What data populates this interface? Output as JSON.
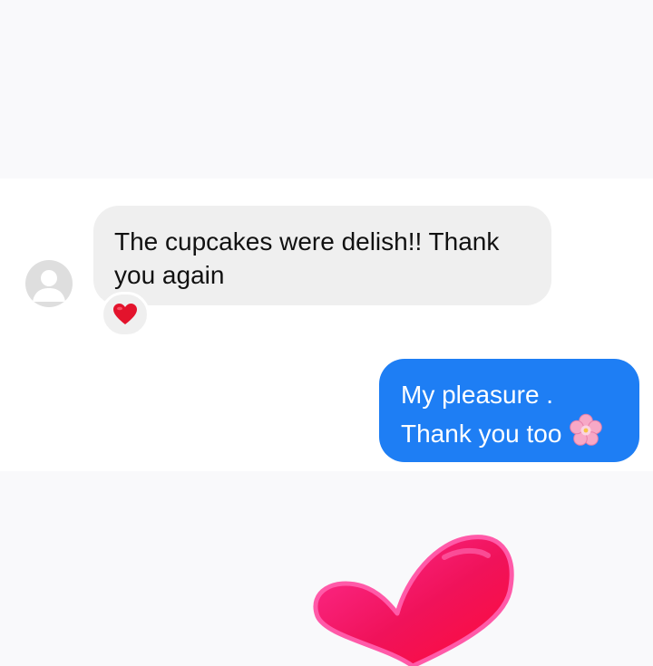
{
  "conversation": {
    "incoming": {
      "avatar": "default-profile-avatar",
      "line1": "The cupcakes were delish!! Thank",
      "line2": "you again",
      "reaction": "red-heart-icon"
    },
    "outgoing": {
      "line1": "My pleasure .",
      "line2": "Thank you too",
      "emoji": "cherry-blossom-icon"
    }
  },
  "overlay": {
    "sticker": "pink-heart-sticker-icon"
  },
  "colors": {
    "outgoing_bubble": "#1e7ef4",
    "incoming_bubble": "#efefef",
    "chat_background": "#ffffff",
    "page_background": "#f9f9fb",
    "heart_sticker": "#f0125a"
  }
}
